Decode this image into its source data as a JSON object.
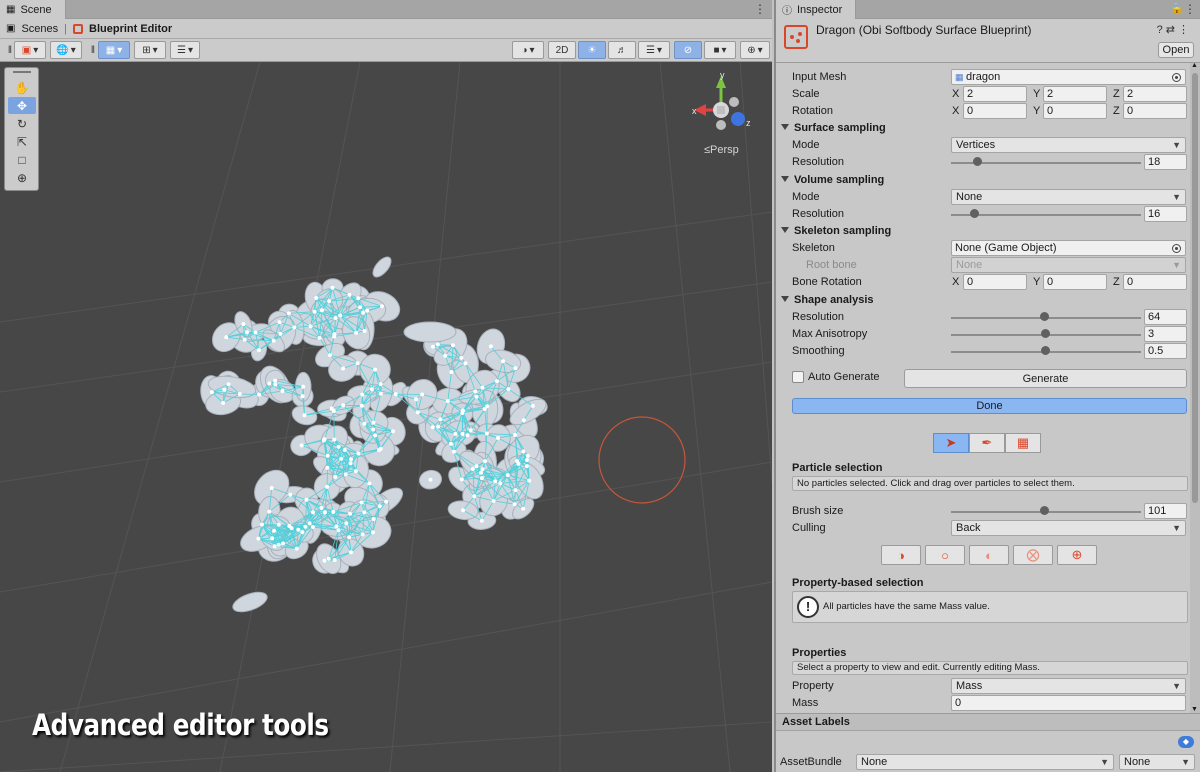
{
  "scene": {
    "tab_label": "Scene",
    "breadcrumb": [
      "Scenes",
      "Blueprint Editor"
    ],
    "toolbar": {
      "two_d_label": "2D"
    },
    "gizmo": {
      "y": "y",
      "x": "x",
      "z": "z"
    },
    "persp_label": "≤Persp",
    "caption": "Advanced editor tools"
  },
  "inspector": {
    "tab_label": "Inspector",
    "title": "Dragon (Obi Softbody Surface Blueprint)",
    "open_label": "Open",
    "input_mesh": {
      "label": "Input Mesh",
      "value": "dragon"
    },
    "scale": {
      "label": "Scale",
      "x": "2",
      "y": "2",
      "z": "2"
    },
    "rotation": {
      "label": "Rotation",
      "x": "0",
      "y": "0",
      "z": "0"
    },
    "axes": {
      "x": "X",
      "y": "Y",
      "z": "Z"
    },
    "surface_sampling": {
      "title": "Surface sampling",
      "mode_label": "Mode",
      "mode_value": "Vertices",
      "resolution_label": "Resolution",
      "resolution_value": "18",
      "resolution_fraction": 0.12
    },
    "volume_sampling": {
      "title": "Volume sampling",
      "mode_label": "Mode",
      "mode_value": "None",
      "resolution_label": "Resolution",
      "resolution_value": "16",
      "resolution_fraction": 0.1
    },
    "skeleton_sampling": {
      "title": "Skeleton sampling",
      "skeleton_label": "Skeleton",
      "skeleton_value": "None (Game Object)",
      "root_bone_label": "Root bone",
      "root_bone_value": "None",
      "bone_rotation_label": "Bone Rotation",
      "bx": "0",
      "by": "0",
      "bz": "0"
    },
    "shape_analysis": {
      "title": "Shape analysis",
      "resolution_label": "Resolution",
      "resolution_value": "64",
      "anisotropy_label": "Max Anisotropy",
      "anisotropy_value": "3",
      "smoothing_label": "Smoothing",
      "smoothing_value": "0.5"
    },
    "auto_generate_label": "Auto Generate",
    "generate_label": "Generate",
    "done_label": "Done",
    "particle_selection": {
      "title": "Particle selection",
      "info": "No particles selected. Click and drag over particles to select them.",
      "brush_size_label": "Brush size",
      "brush_size_value": "101",
      "culling_label": "Culling",
      "culling_value": "Back"
    },
    "property_selection": {
      "title": "Property-based selection",
      "info": "All particles have the same Mass value."
    },
    "properties": {
      "title": "Properties",
      "info": "Select a property to view and edit. Currently editing Mass.",
      "property_label": "Property",
      "property_value": "Mass",
      "mass_label": "Mass",
      "mass_value": "0"
    },
    "asset_labels": {
      "title": "Asset Labels",
      "assetbundle_label": "AssetBundle",
      "bundle_value": "None",
      "variant_value": "None"
    }
  },
  "colors": {
    "accent_blue": "#8ab6f2",
    "obi_red": "#d9472b",
    "wire_cyan": "#4fd1dc",
    "viewport_bg": "#474747"
  }
}
